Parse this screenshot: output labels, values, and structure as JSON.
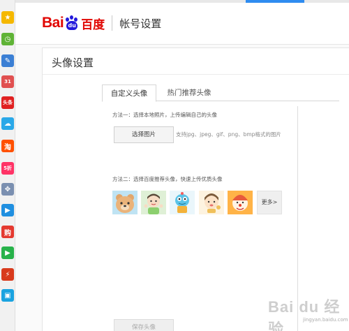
{
  "header": {
    "logo_latin_1": "Bai",
    "logo_latin_2": "du",
    "logo_chinese": "百度",
    "page_title": "帐号设置"
  },
  "card": {
    "title": "头像设置"
  },
  "tabs": [
    {
      "label": "自定义头像",
      "active": true
    },
    {
      "label": "热门推荐头像",
      "active": false
    }
  ],
  "method1": {
    "label": "方法一：选择本地照片，上传编辑自己的头像",
    "button_label": "选择图片",
    "hint": "支持jpg、jpeg、gif、png、bmp格式的图片"
  },
  "method2": {
    "label": "方法二：选择百度推荐头像，快速上传优质头像",
    "avatars": [
      "bear-avatar",
      "kid-avatar",
      "robot-avatar",
      "girl-avatar",
      "clown-avatar"
    ],
    "more_label": "更多>"
  },
  "save_button_label": "保存头像",
  "dock_icons": [
    {
      "name": "favorites-star-icon",
      "glyph": "★",
      "color": "#f5b800"
    },
    {
      "name": "history-clock-icon",
      "glyph": "◷",
      "color": "#5fb336"
    },
    {
      "name": "notes-icon",
      "glyph": "✎",
      "color": "#3b7fd4"
    },
    {
      "name": "calendar-icon",
      "glyph": "31",
      "color": "#e05050"
    },
    {
      "name": "headlines-icon",
      "glyph": "头条",
      "color": "#e02020"
    },
    {
      "name": "weather-icon",
      "glyph": "☁",
      "color": "#2aa8e8"
    },
    {
      "name": "taobao-icon",
      "glyph": "淘",
      "color": "#ff5000"
    },
    {
      "name": "shop-icon",
      "glyph": "5折",
      "color": "#ff3366"
    },
    {
      "name": "games-icon",
      "glyph": "✥",
      "color": "#7a8fb0"
    },
    {
      "name": "video-icon",
      "glyph": "▶",
      "color": "#1f8fe0"
    },
    {
      "name": "shopping-bag-icon",
      "glyph": "购",
      "color": "#e4392f"
    },
    {
      "name": "play-icon",
      "glyph": "▶",
      "color": "#27b24a"
    },
    {
      "name": "lightning-icon",
      "glyph": "⚡",
      "color": "#d83a1c"
    },
    {
      "name": "tv-icon",
      "glyph": "▣",
      "color": "#1aa3e0"
    }
  ],
  "watermark": {
    "text_main": "Bai du 经验",
    "text_sub": "jingyan.baidu.com"
  },
  "colors": {
    "brand_red": "#e10602",
    "brand_blue": "#2319dc",
    "top_tab_accent": "#2f8cf0"
  }
}
